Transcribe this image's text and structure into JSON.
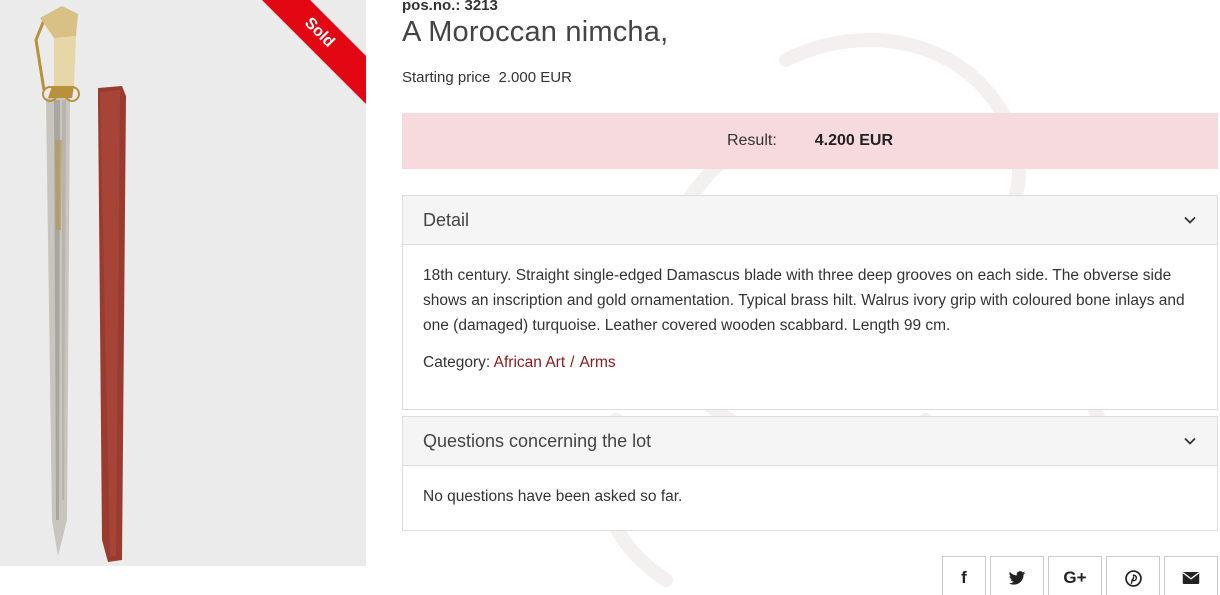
{
  "lot": {
    "pos_label": "pos.no.:",
    "pos_number": "3213",
    "title": "A Moroccan nimcha,",
    "starting_price_label": "Starting price",
    "starting_price_value": "2.000 EUR",
    "sold_badge": "Sold"
  },
  "result": {
    "label": "Result:",
    "value": "4.200 EUR"
  },
  "detail": {
    "heading": "Detail",
    "description": "18th century. Straight single-edged Damascus blade with three deep grooves on each side. The obverse side shows an inscription and gold ornamentation. Typical brass hilt. Walrus ivory grip with coloured bone inlays and one (damaged) turquoise. Leather covered wooden scabbard. Length 99 cm.",
    "category_label": "Category:",
    "category_links": [
      "African Art",
      "Arms"
    ],
    "category_separator": "/"
  },
  "questions": {
    "heading": "Questions concerning the lot",
    "empty_text": "No questions have been asked so far."
  },
  "share": {
    "buttons": [
      {
        "icon": "facebook-icon",
        "glyph": "f"
      },
      {
        "icon": "twitter-icon",
        "glyph": ""
      },
      {
        "icon": "google-plus-icon",
        "glyph": "G+"
      },
      {
        "icon": "pinterest-icon",
        "glyph": ""
      },
      {
        "icon": "email-icon",
        "glyph": ""
      }
    ]
  },
  "colors": {
    "accent_link": "#8b1a1a",
    "sold_ribbon": "#e30613",
    "result_background": "#f7dadd",
    "panel_header": "#f5f5f5",
    "image_background": "#ebebeb"
  }
}
